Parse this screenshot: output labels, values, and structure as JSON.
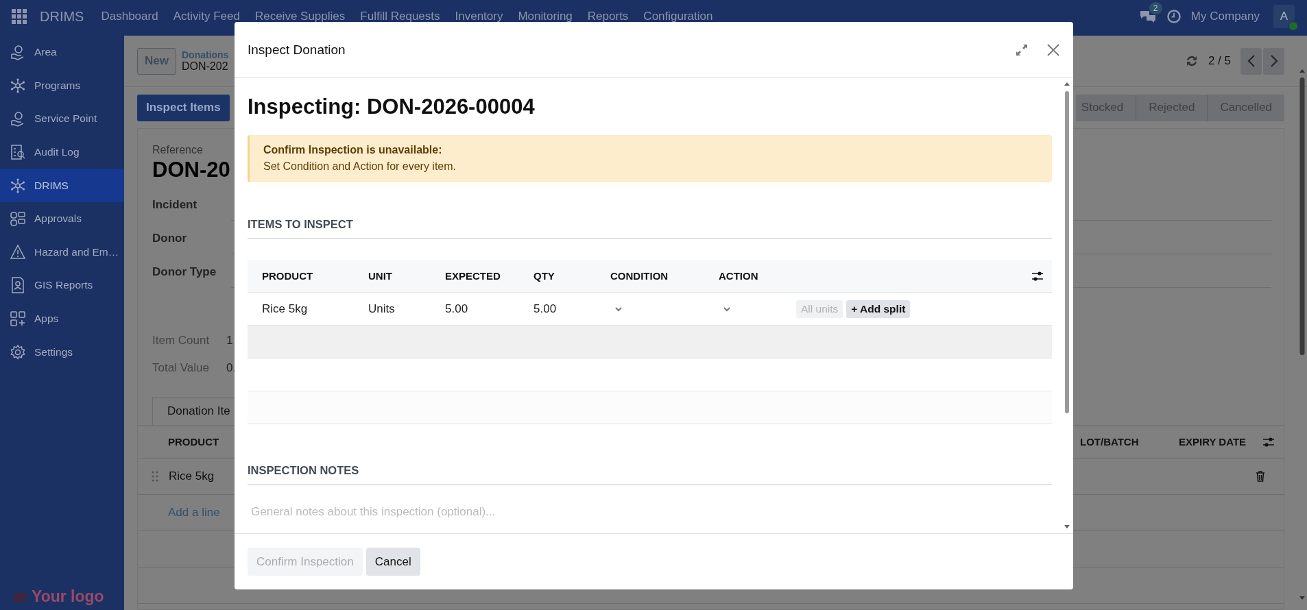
{
  "navbar": {
    "app_name": "DRIMS",
    "menu": [
      "Dashboard",
      "Activity Feed",
      "Receive Supplies",
      "Fulfill Requests",
      "Inventory",
      "Monitoring",
      "Reports",
      "Configuration"
    ],
    "message_count": "2",
    "company": "My Company",
    "avatar_initial": "A"
  },
  "sidebar": {
    "items": [
      {
        "label": "Area",
        "selected": false
      },
      {
        "label": "Programs",
        "selected": false
      },
      {
        "label": "Service Point",
        "selected": false
      },
      {
        "label": "Audit Log",
        "selected": false
      },
      {
        "label": "DRIMS",
        "selected": true
      },
      {
        "label": "Approvals",
        "selected": false
      },
      {
        "label": "Hazard and Em…",
        "selected": false
      },
      {
        "label": "GIS Reports",
        "selected": false
      },
      {
        "label": "Apps",
        "selected": false
      },
      {
        "label": "Settings",
        "selected": false
      }
    ],
    "logo_text": "Your logo"
  },
  "control_panel": {
    "new_button": "New",
    "breadcrumb": "Donations",
    "record": "DON-202",
    "pager": "2 / 5"
  },
  "action_button": "Inspect Items",
  "status_bar": [
    {
      "label": "Stocked",
      "selected": false
    },
    {
      "label": "Rejected",
      "selected": false
    },
    {
      "label": "Cancelled",
      "selected": false
    }
  ],
  "form": {
    "reference_label": "Reference",
    "reference": "DON-20",
    "fields": [
      {
        "label": "Incident"
      },
      {
        "label": "Donor"
      },
      {
        "label": "Donor Type"
      }
    ],
    "summary": [
      {
        "label": "Item Count",
        "value": "1"
      },
      {
        "label": "Total Value",
        "value": "0."
      }
    ],
    "tab": "Donation Ite",
    "lines": {
      "columns": [
        "PRODUCT",
        "LOT/BATCH",
        "EXPIRY DATE"
      ],
      "rows": [
        {
          "product": "Rice 5kg"
        }
      ],
      "add_line": "Add a line"
    }
  },
  "dialog": {
    "title": "Inspect Donation",
    "heading": "Inspecting: DON-2026-00004",
    "alert": {
      "title": "Confirm Inspection is unavailable:",
      "message": "Set Condition and Action for every item."
    },
    "items_section": "ITEMS TO INSPECT",
    "columns": [
      "PRODUCT",
      "UNIT",
      "EXPECTED",
      "QTY",
      "CONDITION",
      "ACTION"
    ],
    "rows": [
      {
        "product": "Rice 5kg",
        "unit": "Units",
        "expected": "5.00",
        "qty": "5.00",
        "all_units": {
          "label": "All units",
          "disabled": true
        },
        "add_split": "+ Add split"
      }
    ],
    "notes_section": "INSPECTION NOTES",
    "notes_placeholder": "General notes about this inspection (optional)...",
    "buttons": [
      {
        "label": "Confirm Inspection",
        "disabled": true
      },
      {
        "label": "Cancel",
        "disabled": false
      }
    ]
  }
}
